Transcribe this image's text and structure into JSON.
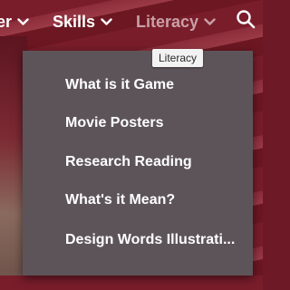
{
  "nav": {
    "prev_label": "er",
    "skills_label": "Skills",
    "literacy_label": "Literacy"
  },
  "tooltip": {
    "text": "Literacy"
  },
  "dropdown": {
    "items": [
      {
        "label": "What is it Game"
      },
      {
        "label": "Movie Posters"
      },
      {
        "label": "Research Reading"
      },
      {
        "label": "What's it Mean?"
      },
      {
        "label": "Design Words Illustrati..."
      }
    ]
  },
  "icons": {
    "chevron": "chevron-down-icon",
    "search": "search-icon"
  },
  "colors": {
    "background": "#7a1d2b",
    "menu_bg": "#5d5459",
    "active_nav": "#c9a0a6",
    "text": "#ffffff"
  }
}
